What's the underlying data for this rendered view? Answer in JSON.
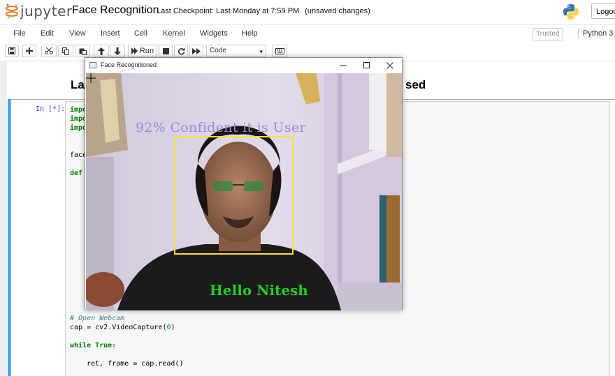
{
  "header": {
    "logo_text": "jupyter",
    "notebook_title": "Face Recognition",
    "checkpoint": "Last Checkpoint: Last Monday at 7:59 PM",
    "unsaved": "(unsaved changes)",
    "logout_label": "Logout"
  },
  "menubar": {
    "items": [
      "File",
      "Edit",
      "View",
      "Insert",
      "Cell",
      "Kernel",
      "Widgets",
      "Help"
    ],
    "trusted": "Trusted",
    "kernel": "Python 3"
  },
  "toolbar": {
    "run_label": "Run",
    "cell_type": "Code",
    "icons": [
      "save-icon",
      "plus-icon",
      "cut-icon",
      "copy-icon",
      "paste-icon",
      "arrow-up-icon",
      "arrow-down-icon",
      "run-icon",
      "stop-icon",
      "restart-icon",
      "fast-forward-icon",
      "keyboard-icon"
    ]
  },
  "notebook": {
    "heading_start": "La",
    "heading_end": "sed",
    "prompt": "In [*]:",
    "code_lines_top": [
      "impo",
      "impo",
      "impo",
      "face",
      "def "
    ],
    "code_comment": "# Open Webcam",
    "code_cap_prefix": "cap = cv2.VideoCapture(",
    "code_cap_arg": "0",
    "code_cap_suffix": ")",
    "code_while": "while True:",
    "code_read": "ret, frame = cap.read()"
  },
  "popup": {
    "title": "Face Recognitioned",
    "overlay_confidence": "92% Confident it is User",
    "overlay_greeting": "Hello Nitesh",
    "colors": {
      "confidence_text": "#9b8be0",
      "greeting_text": "#22cc22",
      "face_box": "#ffe033"
    }
  }
}
